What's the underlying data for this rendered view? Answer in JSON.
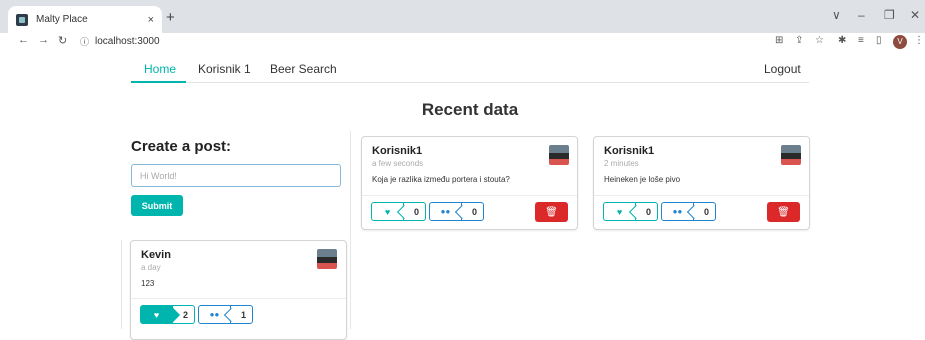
{
  "browser": {
    "tab_title": "Malty Place",
    "tab_close": "×",
    "new_tab": "+",
    "url": "localhost:3000",
    "profile_initial": "V",
    "controls": {
      "chevron": "∨",
      "minimize": "–",
      "restore": "❐",
      "close": "✕"
    }
  },
  "nav": {
    "home": "Home",
    "korisnik": "Korisnik 1",
    "beer_search": "Beer Search",
    "logout": "Logout"
  },
  "heading": "Recent data",
  "create": {
    "label": "Create a post:",
    "placeholder": "Hi World!",
    "submit": "Submit"
  },
  "posts": [
    {
      "author": "Korisnik1",
      "time": "a few seconds",
      "text": "Koja je razlika između portera i stouta?",
      "likes": "0",
      "comments": "0"
    },
    {
      "author": "Korisnik1",
      "time": "2 minutes",
      "text": "Heineken je loše pivo",
      "likes": "0",
      "comments": "0"
    },
    {
      "author": "Kevin",
      "time": "a day",
      "text": "123",
      "likes": "2",
      "comments": "1"
    }
  ],
  "colors": {
    "accent": "#00b5ad",
    "blue": "#2185d0",
    "danger": "#db2828"
  }
}
